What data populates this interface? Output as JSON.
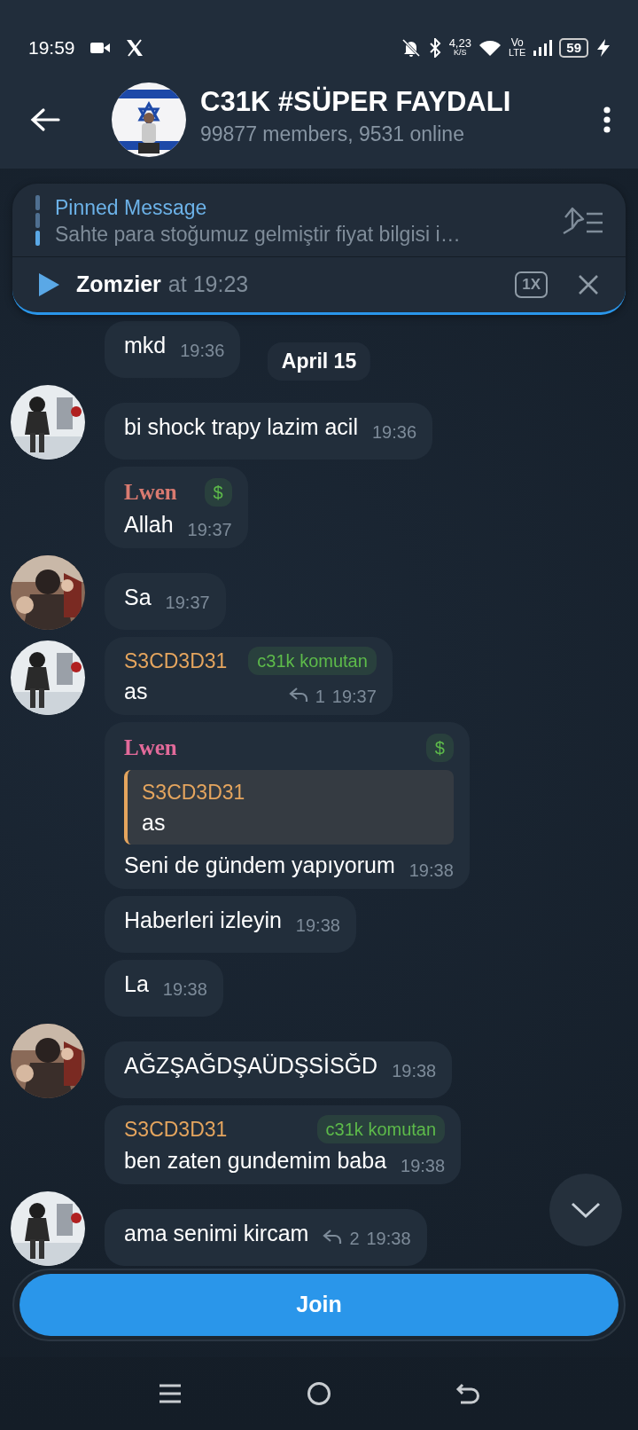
{
  "status_bar": {
    "time": "19:59",
    "speed": "4,23",
    "speed_unit": "K/S",
    "net_top": "Vo",
    "net_bottom": "LTE",
    "battery": "59"
  },
  "header": {
    "title": "C31K #SÜPER FAYDALI",
    "subtitle": "99877 members, 9531 online"
  },
  "pinned": {
    "label": "Pinned Message",
    "text": "Sahte para stoğumuz gelmiştir fiyat bilgisi i…",
    "audio": {
      "name": "Zomzier",
      "time": "at 19:23",
      "speed": "1X"
    }
  },
  "date_pill": "April 15",
  "messages": [
    {
      "text": "mkd",
      "time": "19:36",
      "avatar": false
    },
    {
      "text": "bi shock trapy lazim acil",
      "time": "19:36",
      "avatar": true
    },
    {
      "sender": "Lwen",
      "color": "#d97a70",
      "sender_serif": true,
      "badge": "$",
      "text": "Allah",
      "time": "19:37",
      "avatar": false
    },
    {
      "text": "Sa",
      "time": "19:37",
      "avatar": true
    },
    {
      "sender": "S3CD3D31",
      "color": "#e5a55e",
      "badge": "c31k komutan",
      "text": "as",
      "time": "19:37",
      "replies": "1",
      "avatar": true
    },
    {
      "sender": "Lwen",
      "color": "#e26a9a",
      "sender_serif": true,
      "badge": "$",
      "quote": {
        "sender": "S3CD3D31",
        "color": "#e5a55e",
        "text": "as"
      },
      "text": "Seni de gündem yapıyorum",
      "time": "19:38",
      "avatar": false
    },
    {
      "text": "Haberleri izleyin",
      "time": "19:38",
      "avatar": false
    },
    {
      "text": "La",
      "time": "19:38",
      "avatar": false
    },
    {
      "text": "AĞZŞAĞDŞAÜDŞSİSĞD",
      "time": "19:38",
      "avatar": true
    },
    {
      "sender": "S3CD3D31",
      "color": "#e5a55e",
      "badge": "c31k komutan",
      "text": "ben zaten gundemim baba",
      "time": "19:38",
      "avatar": false
    },
    {
      "text": "ama senimi kircam",
      "time": "19:38",
      "replies": "2",
      "avatar": true
    }
  ],
  "join_button": "Join"
}
